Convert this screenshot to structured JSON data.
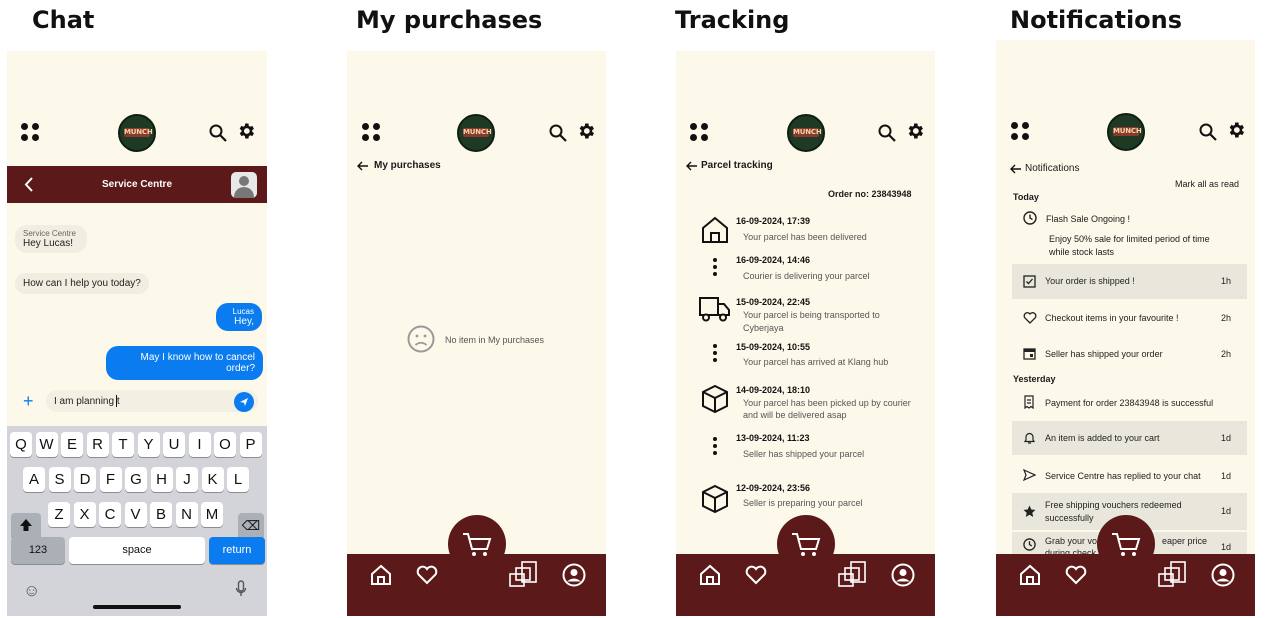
{
  "titles": {
    "chat": "Chat",
    "purchases": "My purchases",
    "tracking": "Tracking",
    "notifications": "Notifications"
  },
  "brand": {
    "logo_text": "MUNCH",
    "bar_color": "#5b1919",
    "bg_color": "#fcf9ea"
  },
  "chat": {
    "header_title": "Service Centre",
    "messages": [
      {
        "from": "Service Centre",
        "text": "Hey Lucas!"
      },
      {
        "from": "",
        "text": "How can I help you today?"
      },
      {
        "from": "Lucas",
        "text": "Hey,"
      },
      {
        "from": "",
        "text": "May I know how to cancel order?"
      }
    ],
    "input_value": "I am planning t",
    "keyboard": {
      "row1": [
        "Q",
        "W",
        "E",
        "R",
        "T",
        "Y",
        "U",
        "I",
        "O",
        "P"
      ],
      "row2": [
        "A",
        "S",
        "D",
        "F",
        "G",
        "H",
        "J",
        "K",
        "L"
      ],
      "row3": [
        "Z",
        "X",
        "C",
        "V",
        "B",
        "N",
        "M"
      ],
      "key_123": "123",
      "key_space": "space",
      "key_return": "return"
    }
  },
  "purchases": {
    "back_label": "My purchases",
    "empty_text": "No item in My purchases"
  },
  "tracking": {
    "back_label": "Parcel tracking",
    "order_no": "Order no: 23843948",
    "events": [
      {
        "date": "16-09-2024, 17:39",
        "desc": "Your parcel has been delivered",
        "icon": "house-icon"
      },
      {
        "date": "16-09-2024, 14:46",
        "desc": "Courier is delivering your parcel",
        "icon": "dots-icon"
      },
      {
        "date": "15-09-2024, 22:45",
        "desc": "Your parcel is being transported to",
        "desc2": "Cyberjaya",
        "icon": "truck-icon"
      },
      {
        "date": "15-09-2024, 10:55",
        "desc": "Your parcel has arrived at Klang hub",
        "icon": "dots-icon"
      },
      {
        "date": "14-09-2024, 18:10",
        "desc": "Your parcel has been picked up by courier",
        "desc2": "and will be delivered asap",
        "icon": "box-icon"
      },
      {
        "date": "13-09-2024, 11:23",
        "desc": "Seller has shipped your parcel",
        "icon": "dots-icon"
      },
      {
        "date": "12-09-2024, 23:56",
        "desc": "Seller is preparing your parcel",
        "icon": "box-icon"
      }
    ]
  },
  "notifications": {
    "back_label": "Notifications",
    "mark_all": "Mark all as read",
    "today_label": "Today",
    "yesterday_label": "Yesterday",
    "flash_title": "Flash Sale Ongoing !",
    "flash_desc1": "Enjoy 50% sale for limited period of time",
    "flash_desc2": "while stock lasts",
    "items": [
      {
        "text": "Your order is shipped !",
        "time": "1h",
        "icon": "checkbox-icon"
      },
      {
        "text": "Checkout items in your favourite !",
        "time": "2h",
        "icon": "heart-icon"
      },
      {
        "text": "Seller has shipped your order",
        "time": "2h",
        "icon": "calendar-icon"
      },
      {
        "text": "Payment for order 23843948 is successful",
        "time": "",
        "icon": "receipt-icon"
      },
      {
        "text": "An item is added to your cart",
        "time": "1d",
        "icon": "bell-icon"
      },
      {
        "text": "Service Centre has replied to your chat",
        "time": "1d",
        "icon": "send-icon"
      },
      {
        "text": "Free shipping vouchers redeemed",
        "text2": "successfully",
        "time": "1d",
        "icon": "star-icon"
      },
      {
        "text": "Grab your vo",
        "text_end": "eaper price",
        "text2": "during check",
        "time": "1d",
        "icon": "clock-icon"
      }
    ]
  }
}
